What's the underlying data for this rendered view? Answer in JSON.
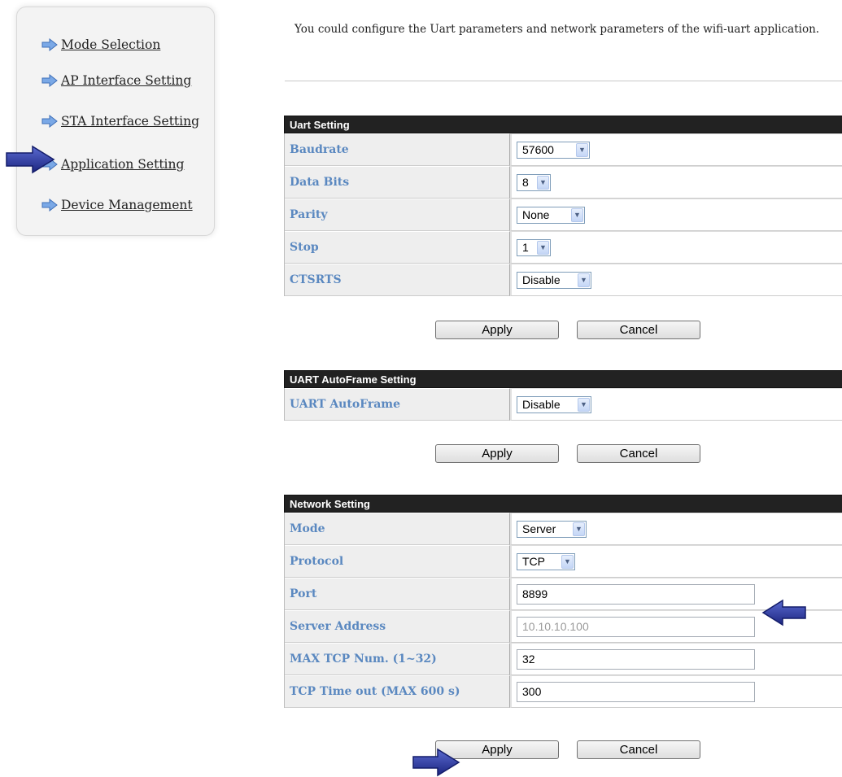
{
  "sidebar": {
    "items": [
      {
        "label": "Mode Selection"
      },
      {
        "label": "AP Interface Setting"
      },
      {
        "label": "STA Interface Setting"
      },
      {
        "label": "Application Setting"
      },
      {
        "label": "Device Management"
      }
    ]
  },
  "intro": "You could configure the Uart parameters and network parameters of the wifi-uart application.",
  "uart": {
    "title": "Uart Setting",
    "rows": [
      {
        "label": "Baudrate",
        "value": "57600"
      },
      {
        "label": "Data Bits",
        "value": "8"
      },
      {
        "label": "Parity",
        "value": "None"
      },
      {
        "label": "Stop",
        "value": "1"
      },
      {
        "label": "CTSRTS",
        "value": "Disable"
      }
    ],
    "apply": "Apply",
    "cancel": "Cancel"
  },
  "autoframe": {
    "title": "UART AutoFrame Setting",
    "rows": [
      {
        "label": "UART AutoFrame",
        "value": "Disable"
      }
    ],
    "apply": "Apply",
    "cancel": "Cancel"
  },
  "network": {
    "title": "Network Setting",
    "mode": {
      "label": "Mode",
      "value": "Server"
    },
    "protocol": {
      "label": "Protocol",
      "value": "TCP"
    },
    "port": {
      "label": "Port",
      "value": "8899"
    },
    "server": {
      "label": "Server Address",
      "value": "10.10.10.100"
    },
    "maxtcp": {
      "label": "MAX TCP Num. (1~32)",
      "value": "32"
    },
    "timeout": {
      "label": "TCP Time out (MAX 600 s)",
      "value": "300"
    },
    "apply": "Apply",
    "cancel": "Cancel"
  },
  "colors": {
    "header_bg": "#222222",
    "label_text": "#5a88c0",
    "arrow": "#2a3a9a"
  },
  "icons": {
    "bullet": "arrow-right-icon",
    "pointer": "big-arrow-icon"
  }
}
